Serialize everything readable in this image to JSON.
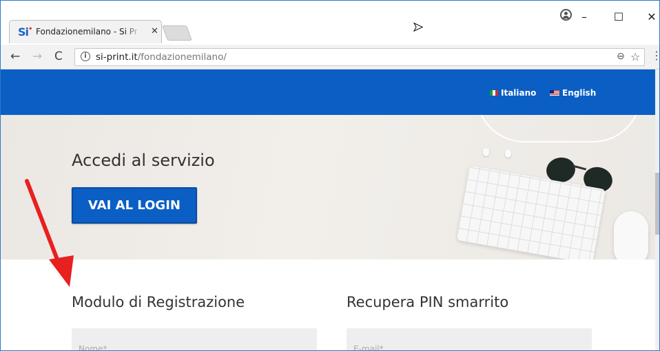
{
  "browser": {
    "tab_title": "Fondazionemilano - Si Pr",
    "tab_favicon_text": "Si",
    "url_host": "si-print.it",
    "url_path": "/fondazionemilano/",
    "window_controls": {
      "minimize": "–",
      "maximize": "☐",
      "close": "✕"
    }
  },
  "header": {
    "languages": [
      {
        "label": "Italiano",
        "flag": "it-flag-icon"
      },
      {
        "label": "English",
        "flag": "us-flag-icon"
      }
    ]
  },
  "hero": {
    "title": "Accedi al servizio",
    "login_button": "VAI AL LOGIN"
  },
  "registration": {
    "title": "Modulo di Registrazione",
    "name_placeholder": "Nome*"
  },
  "recover_pin": {
    "title": "Recupera PIN smarrito",
    "email_placeholder": "E-mail*"
  },
  "colors": {
    "brand_blue": "#0b5ec4",
    "annotation_arrow": "#e8201f"
  }
}
